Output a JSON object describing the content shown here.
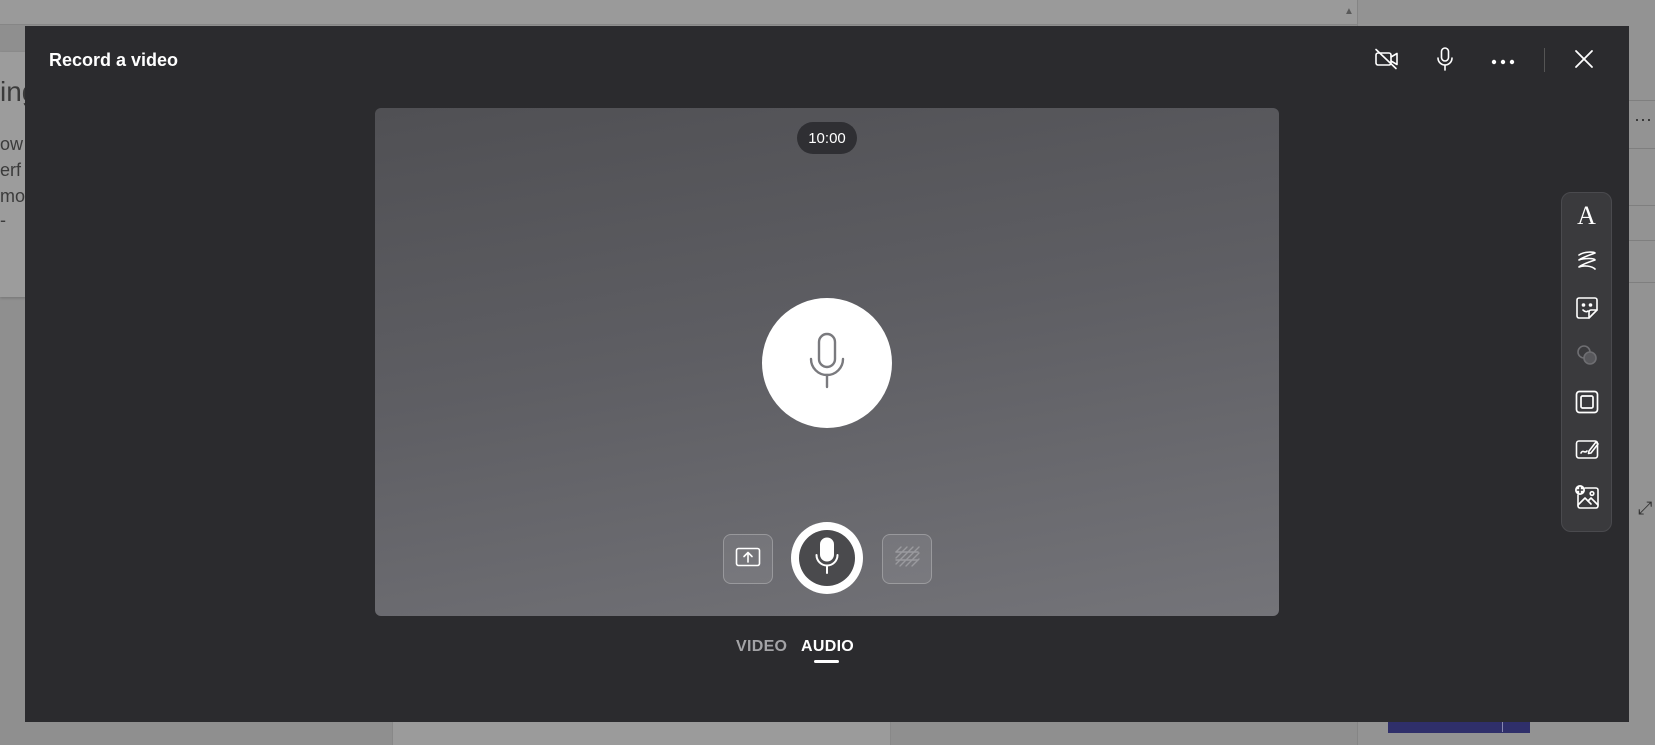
{
  "background": {
    "left_card_lines": [
      "ing",
      "ow",
      "erf",
      "mor",
      "-"
    ]
  },
  "modal": {
    "title": "Record a video",
    "header_buttons": {
      "camera": "camera-off-icon",
      "mic": "microphone-icon",
      "more": "more-options-icon",
      "close": "close-icon"
    },
    "stage": {
      "timer": "10:00",
      "center_icon": "microphone-icon"
    },
    "controls": {
      "left": "share-screen-icon",
      "record": "record-audio-icon",
      "right": "background-effects-icon"
    },
    "mode_tabs": [
      {
        "label": "VIDEO",
        "selected": false
      },
      {
        "label": "AUDIO",
        "selected": true
      }
    ],
    "toolbar": [
      {
        "name": "text",
        "icon": "text-icon",
        "glyph": "A"
      },
      {
        "name": "pen",
        "icon": "pen-icon"
      },
      {
        "name": "stickers",
        "icon": "sticker-icon"
      },
      {
        "name": "filters",
        "icon": "filters-icon",
        "disabled": true
      },
      {
        "name": "frames",
        "icon": "frame-icon"
      },
      {
        "name": "board",
        "icon": "board-icon"
      },
      {
        "name": "add-image",
        "icon": "add-image-icon"
      }
    ]
  },
  "colors": {
    "modal_bg": "#2b2b2e",
    "stage_top": "#505054",
    "stage_bottom": "#747479",
    "toolbar_bg": "#3a3a3d",
    "overlay_bg": "#8f8f8f"
  }
}
